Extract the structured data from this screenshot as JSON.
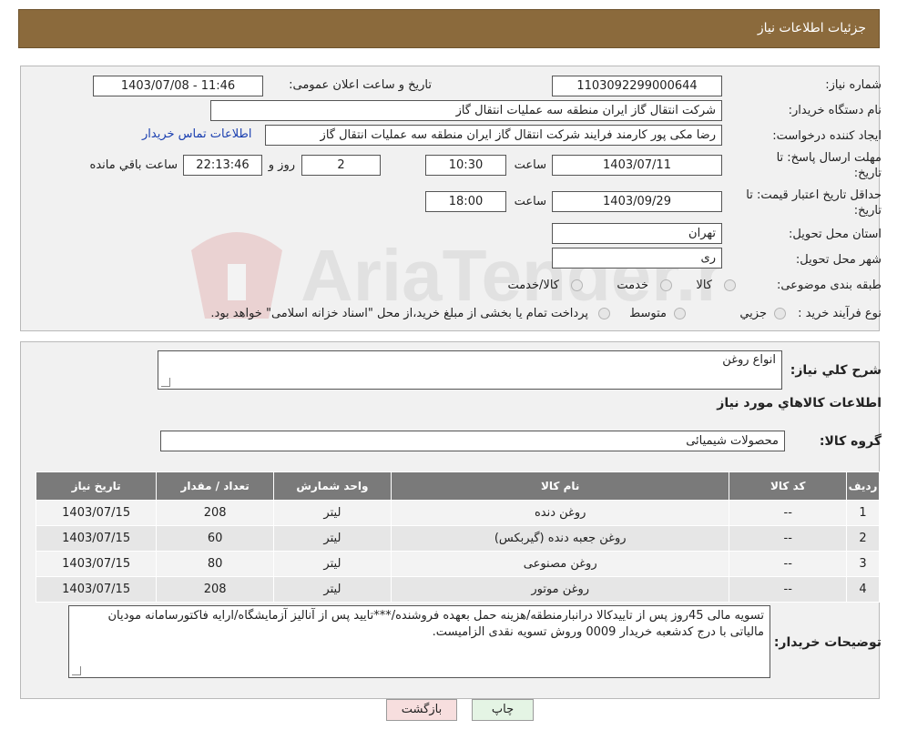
{
  "header": {
    "title": "جزئیات اطلاعات نیاز"
  },
  "form": {
    "need_number_label": "شماره نیاز:",
    "need_number": "1103092299000644",
    "announce_label": "تاریخ و ساعت اعلان عمومی:",
    "announce_value": "1403/07/08 - 11:46",
    "buyer_org_label": "نام دستگاه خریدار:",
    "buyer_org": "شرکت انتقال گاز ایران منطقه سه عملیات انتقال گاز",
    "creator_label": "ایجاد کننده درخواست:",
    "creator": "رضا مکی پور کارمند فرایند شرکت انتقال گاز ایران منطقه سه عملیات انتقال گاز",
    "contact_link": "اطلاعات تماس خریدار",
    "deadline_label_1": "مهلت ارسال پاسخ: تا",
    "deadline_label_2": "تاریخ:",
    "deadline_date": "1403/07/11",
    "time_label": "ساعت",
    "deadline_time": "10:30",
    "days_value": "2",
    "days_label": "روز و",
    "remaining_time": "22:13:46",
    "remaining_label": "ساعت باقي مانده",
    "validity_label_1": "حداقل تاریخ اعتبار قیمت: تا",
    "validity_label_2": "تاریخ:",
    "validity_date": "1403/09/29",
    "validity_time": "18:00",
    "province_label": "استان محل تحویل:",
    "province": "تهران",
    "city_label": "شهر محل تحویل:",
    "city": "ری",
    "category_label": "طبقه بندی موضوعی:",
    "category_options": [
      "کالا",
      "خدمت",
      "کالا/خدمت"
    ],
    "process_label": "نوع فرآیند خرید :",
    "process_options": [
      "جزیي",
      "متوسط"
    ],
    "process_note": "پرداخت تمام یا بخشی از مبلغ خرید،از محل \"اسناد خزانه اسلامی\" خواهد بود."
  },
  "description": {
    "general_label": "شرح كلي نياز:",
    "general_value": "انواع روغن",
    "goods_info_title": "اطلاعات كالاهاي مورد نياز",
    "group_label": "گروه كالا:",
    "group_value": "محصولات شیمیائی"
  },
  "table": {
    "headers": [
      "رديف",
      "کد کالا",
      "نام کالا",
      "واحد شمارش",
      "تعداد / مقدار",
      "تاریخ نیاز"
    ],
    "rows": [
      [
        "1",
        "--",
        "روغن دنده",
        "لیتر",
        "208",
        "1403/07/15"
      ],
      [
        "2",
        "--",
        "روغن جعبه دنده (گیربکس)",
        "لیتر",
        "60",
        "1403/07/15"
      ],
      [
        "3",
        "--",
        "روغن مصنوعی",
        "لیتر",
        "80",
        "1403/07/15"
      ],
      [
        "4",
        "--",
        "روغن موتور",
        "لیتر",
        "208",
        "1403/07/15"
      ]
    ]
  },
  "buyer_notes": {
    "label": "توضیحات خریدار:",
    "text": "تسویه مالی 45روز پس از تاییدکالا درانبارمنطقه/هزینه حمل بعهده فروشنده/***تایید پس از آنالیز آزمایشگاه/ارایه فاکتورسامانه مودیان مالیاتی با درج کدشعبه خریدار 0009 وروش تسویه نقدی الزامیست."
  },
  "buttons": {
    "print": "چاپ",
    "back": "بازگشت"
  },
  "watermark": "AriaTender.neT",
  "colors": {
    "header": "#8b6a3c",
    "link": "#1a3fb0",
    "back_button": "#f7dede",
    "print_button": "#e4f4e4"
  }
}
